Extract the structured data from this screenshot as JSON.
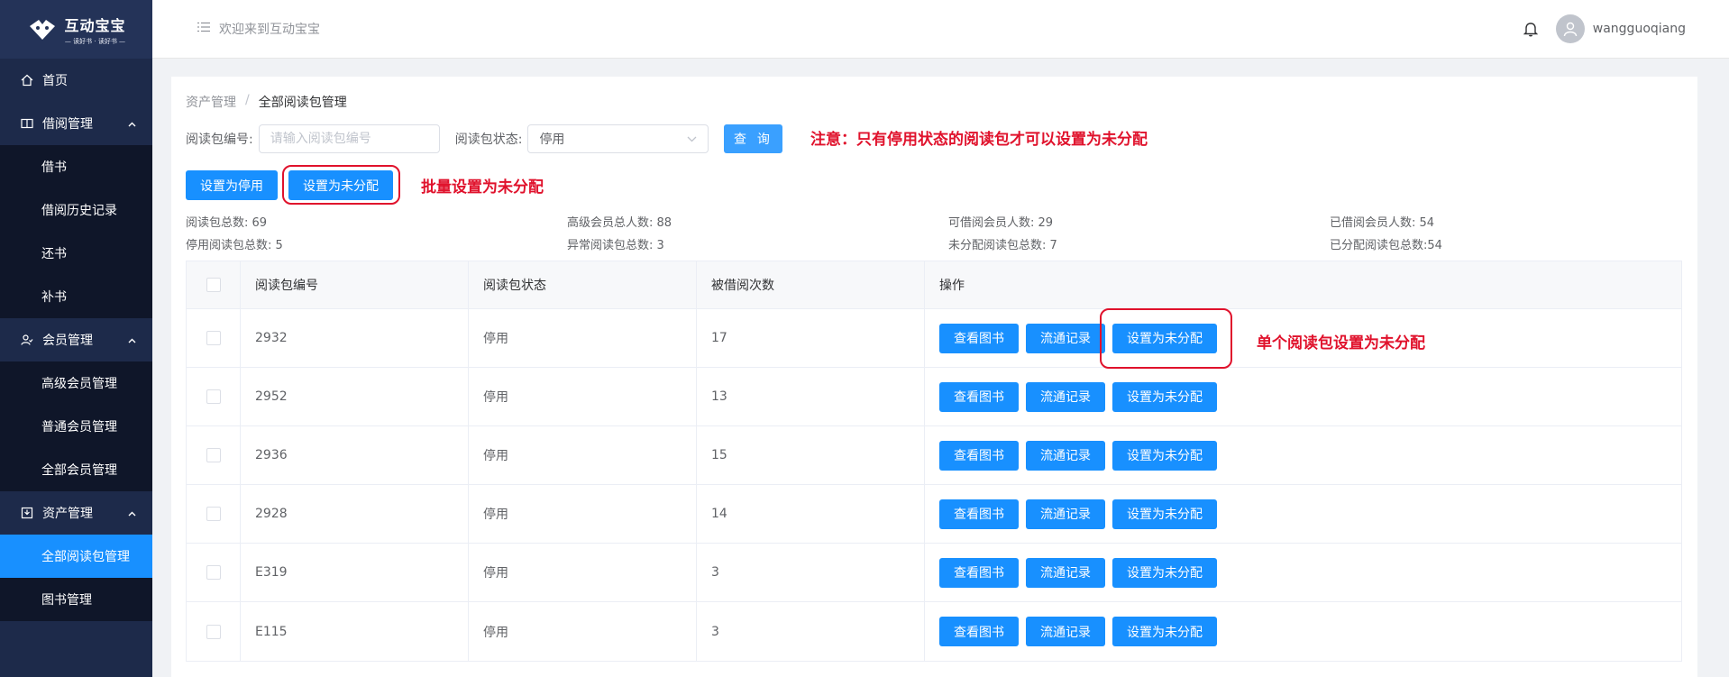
{
  "brand": {
    "title": "互动宝宝",
    "subtitle": "— 读好书 · 读好书 —"
  },
  "header": {
    "welcome": "欢迎来到互动宝宝",
    "username": "wangguoqiang"
  },
  "sidebar": {
    "home": "首页",
    "borrow_group": "借阅管理",
    "borrow_items": [
      "借书",
      "借阅历史记录",
      "还书",
      "补书"
    ],
    "member_group": "会员管理",
    "member_items": [
      "高级会员管理",
      "普通会员管理",
      "全部会员管理"
    ],
    "asset_group": "资产管理",
    "asset_items": [
      "全部阅读包管理",
      "图书管理"
    ]
  },
  "breadcrumb": {
    "parent": "资产管理",
    "separator": "/",
    "current": "全部阅读包管理"
  },
  "filter": {
    "code_label": "阅读包编号:",
    "code_placeholder": "请输入阅读包编号",
    "status_label": "阅读包状态:",
    "status_value": "停用",
    "query_label": "查 询"
  },
  "notes": {
    "top": "注意：只有停用状态的阅读包才可以设置为未分配",
    "batch": "批量设置为未分配",
    "single": "单个阅读包设置为未分配"
  },
  "actions": {
    "disable": "设置为停用",
    "unassign": "设置为未分配"
  },
  "stats": [
    "阅读包总数: 69",
    "高级会员总人数: 88",
    "可借阅会员人数: 29",
    "已借阅会员人数: 54",
    "停用阅读包总数: 5",
    "异常阅读包总数: 3",
    "未分配阅读包总数: 7",
    "已分配阅读包总数:54"
  ],
  "table": {
    "headers": [
      "阅读包编号",
      "阅读包状态",
      "被借阅次数",
      "操作"
    ],
    "row_buttons": [
      "查看图书",
      "流通记录",
      "设置为未分配"
    ],
    "rows": [
      {
        "code": "2932",
        "status": "停用",
        "count": "17"
      },
      {
        "code": "2952",
        "status": "停用",
        "count": "13"
      },
      {
        "code": "2936",
        "status": "停用",
        "count": "15"
      },
      {
        "code": "2928",
        "status": "停用",
        "count": "14"
      },
      {
        "code": "E319",
        "status": "停用",
        "count": "3"
      },
      {
        "code": "E115",
        "status": "停用",
        "count": "3"
      }
    ]
  },
  "colors": {
    "primary": "#1890ff",
    "sidebar": "#1d2a4a",
    "sidebar_sub": "#0f1629",
    "annotation": "#e0122c"
  }
}
